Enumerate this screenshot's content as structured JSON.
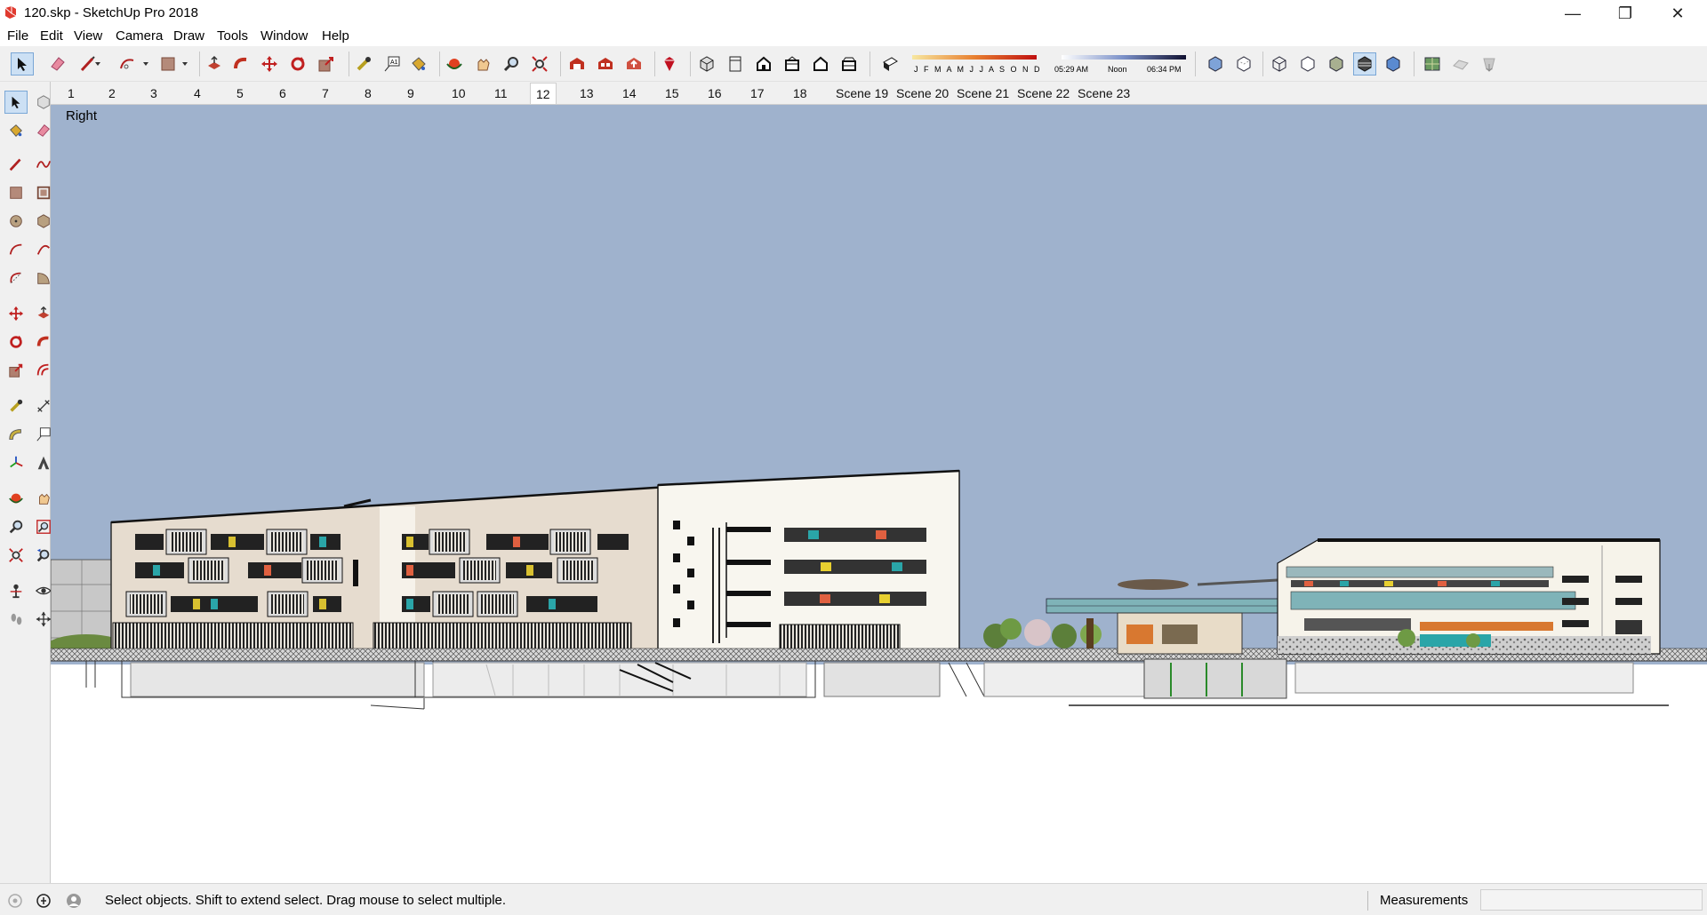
{
  "window": {
    "title": "120.skp - SketchUp Pro 2018",
    "minimize_glyph": "—",
    "restore_glyph": "❐",
    "close_glyph": "✕"
  },
  "menu": [
    "File",
    "Edit",
    "View",
    "Camera",
    "Draw",
    "Tools",
    "Window",
    "Help"
  ],
  "shadow_settings": {
    "months": "J F M A M J J A S O N D",
    "sunrise": "05:29 AM",
    "noon": "Noon",
    "sunset": "06:34 PM"
  },
  "scene_tabs": [
    "1",
    "2",
    "3",
    "4",
    "5",
    "6",
    "7",
    "8",
    "9",
    "10",
    "11",
    "12",
    "13",
    "14",
    "15",
    "16",
    "17",
    "18",
    "Scene 19",
    "Scene 20",
    "Scene 21",
    "Scene 22",
    "Scene 23"
  ],
  "active_scene": "12",
  "viewport": {
    "view_name": "Right",
    "sky_color": "#9fb2cd",
    "ground_color": "#ffffff"
  },
  "status": {
    "hint": "Select objects. Shift to extend select. Drag mouse to select multiple.",
    "measurements_label": "Measurements",
    "measurements_value": ""
  },
  "toolbar_icons": [
    "select-icon",
    "eraser-icon",
    "line-icon",
    "arc-icon",
    "rectangle-icon",
    "push-pull-icon",
    "follow-me-icon",
    "move-icon",
    "rotate-icon",
    "scale-icon",
    "tape-measure-icon",
    "text-icon",
    "paint-bucket-icon",
    "orbit-icon",
    "pan-icon",
    "zoom-icon",
    "zoom-extents-icon",
    "warehouse-icon",
    "extension-warehouse-icon",
    "share-model-icon",
    "ruby-icon",
    "iso-view-icon",
    "top-view-icon",
    "front-view-icon",
    "right-view-icon",
    "back-view-icon",
    "left-view-icon",
    "shadows-icon",
    "xray-icon",
    "back-edges-icon",
    "wireframe-icon",
    "hidden-line-icon",
    "shaded-icon",
    "shaded-textures-icon",
    "monochrome-icon",
    "add-location-icon",
    "toggle-terrain-icon",
    "photo-textures-icon"
  ],
  "palette_icons": [
    "select-icon",
    "make-component-icon",
    "paint-bucket-icon",
    "eraser-icon",
    "line-icon",
    "freehand-icon",
    "rectangle-icon",
    "rotated-rectangle-icon",
    "circle-icon",
    "polygon-icon",
    "arc-icon",
    "two-point-arc-icon",
    "three-point-arc-icon",
    "pie-icon",
    "move-icon",
    "push-pull-icon",
    "rotate-icon",
    "follow-me-icon",
    "scale-icon",
    "offset-icon",
    "tape-measure-icon",
    "dimension-icon",
    "protractor-icon",
    "text-icon",
    "axes-icon",
    "3d-text-icon",
    "orbit-icon",
    "pan-icon",
    "zoom-icon",
    "zoom-window-icon",
    "zoom-extents-icon",
    "previous-view-icon",
    "position-camera-icon",
    "look-around-icon",
    "walk-icon",
    "section-plane-icon"
  ]
}
